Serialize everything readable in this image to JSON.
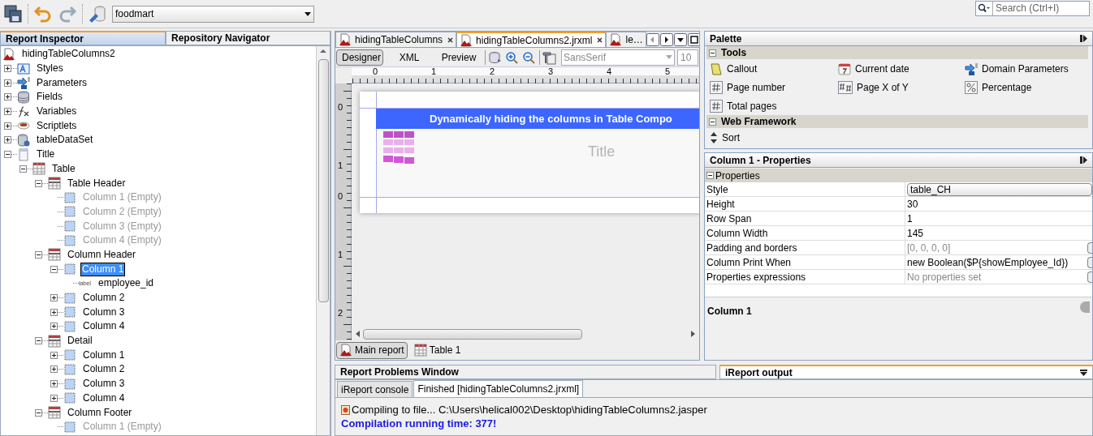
{
  "toolbar": {
    "datasource": "foodmart",
    "search_placeholder": "Search (Ctrl+I)"
  },
  "inspector": {
    "tabs": [
      {
        "label": "Report Inspector",
        "selected": true
      },
      {
        "label": "Repository Navigator",
        "selected": false
      }
    ],
    "tree": {
      "label": "hidingTableColumns2",
      "kind": "report",
      "selected": false,
      "disabled": false,
      "children": [
        {
          "label": "Styles",
          "kind": "styles",
          "expanded": false,
          "selected": false,
          "disabled": false
        },
        {
          "label": "Parameters",
          "kind": "parameters",
          "expanded": false,
          "selected": false,
          "disabled": false
        },
        {
          "label": "Fields",
          "kind": "fields",
          "expanded": false,
          "selected": false,
          "disabled": false
        },
        {
          "label": "Variables",
          "kind": "variables",
          "expanded": false,
          "selected": false,
          "disabled": false
        },
        {
          "label": "Scriptlets",
          "kind": "scriptlets",
          "expanded": false,
          "selected": false,
          "disabled": false
        },
        {
          "label": "tableDataSet",
          "kind": "dataset",
          "expanded": false,
          "selected": false,
          "disabled": false
        },
        {
          "label": "Title",
          "kind": "band",
          "expanded": true,
          "selected": false,
          "disabled": false,
          "children": [
            {
              "label": "Table",
              "kind": "table",
              "expanded": true,
              "selected": false,
              "disabled": false,
              "children": [
                {
                  "label": "Table Header",
                  "kind": "section",
                  "expanded": true,
                  "selected": false,
                  "disabled": false,
                  "children": [
                    {
                      "label": "Column 1 (Empty)",
                      "kind": "cell",
                      "selected": false,
                      "disabled": true
                    },
                    {
                      "label": "Column 2 (Empty)",
                      "kind": "cell",
                      "selected": false,
                      "disabled": true
                    },
                    {
                      "label": "Column 3 (Empty)",
                      "kind": "cell",
                      "selected": false,
                      "disabled": true
                    },
                    {
                      "label": "Column 4 (Empty)",
                      "kind": "cell",
                      "selected": false,
                      "disabled": true
                    }
                  ]
                },
                {
                  "label": "Column Header",
                  "kind": "section",
                  "expanded": true,
                  "selected": false,
                  "disabled": false,
                  "children": [
                    {
                      "label": "Column 1",
                      "kind": "cell",
                      "expanded": true,
                      "selected": true,
                      "disabled": false,
                      "children": [
                        {
                          "label": "employee_id",
                          "kind": "label",
                          "badge": "label",
                          "selected": false,
                          "disabled": false
                        }
                      ]
                    },
                    {
                      "label": "Column 2",
                      "kind": "cell",
                      "expanded": false,
                      "selected": false,
                      "disabled": false
                    },
                    {
                      "label": "Column 3",
                      "kind": "cell",
                      "expanded": false,
                      "selected": false,
                      "disabled": false
                    },
                    {
                      "label": "Column 4",
                      "kind": "cell",
                      "expanded": false,
                      "selected": false,
                      "disabled": false
                    }
                  ]
                },
                {
                  "label": "Detail",
                  "kind": "section",
                  "expanded": true,
                  "selected": false,
                  "disabled": false,
                  "children": [
                    {
                      "label": "Column 1",
                      "kind": "cell",
                      "expanded": false,
                      "selected": false,
                      "disabled": false
                    },
                    {
                      "label": "Column 2",
                      "kind": "cell",
                      "expanded": false,
                      "selected": false,
                      "disabled": false
                    },
                    {
                      "label": "Column 3",
                      "kind": "cell",
                      "expanded": false,
                      "selected": false,
                      "disabled": false
                    },
                    {
                      "label": "Column 4",
                      "kind": "cell",
                      "expanded": false,
                      "selected": false,
                      "disabled": false
                    }
                  ]
                },
                {
                  "label": "Column Footer",
                  "kind": "section",
                  "expanded": true,
                  "selected": false,
                  "disabled": false,
                  "children": [
                    {
                      "label": "Column 1 (Empty)",
                      "kind": "cell",
                      "selected": false,
                      "disabled": true
                    }
                  ]
                }
              ]
            }
          ]
        }
      ]
    }
  },
  "designer": {
    "file_tabs": [
      {
        "label": "hidingTableColumns",
        "selected": false,
        "closable": true
      },
      {
        "label": "hidingTableColumns2.jrxml",
        "selected": true,
        "closable": true
      },
      {
        "label": "le…",
        "selected": false,
        "closable": false
      }
    ],
    "view_tabs": [
      {
        "label": "Designer",
        "selected": true
      },
      {
        "label": "XML",
        "selected": false
      },
      {
        "label": "Preview",
        "selected": false
      }
    ],
    "font": "SansSerif",
    "font_size": "10",
    "ruler_h": [
      "0",
      "1",
      "2",
      "3",
      "4",
      "5"
    ],
    "ruler_v": [
      "0",
      "1",
      "0",
      "1",
      "2"
    ],
    "band_title": "Dynamically hiding the columns in Table Compo",
    "title_placeholder": "Title",
    "report_tabs": [
      {
        "label": "Main report",
        "kind": "report",
        "selected": true
      },
      {
        "label": "Table 1",
        "kind": "table",
        "selected": false
      }
    ]
  },
  "palette": {
    "title": "Palette",
    "sections": [
      {
        "label": "Tools",
        "expanded": true,
        "items": [
          {
            "label": "Callout",
            "kind": "callout"
          },
          {
            "label": "Current date",
            "kind": "calendar"
          },
          {
            "label": "Domain Parameters",
            "kind": "parameters"
          },
          {
            "label": "Page number",
            "kind": "hash"
          },
          {
            "label": "Page X of Y",
            "kind": "hash2"
          },
          {
            "label": "Percentage",
            "kind": "percent"
          },
          {
            "label": "Total pages",
            "kind": "hash"
          }
        ]
      },
      {
        "label": "Web Framework",
        "expanded": true,
        "items": [
          {
            "label": "Sort",
            "kind": "sort"
          }
        ]
      }
    ]
  },
  "properties": {
    "title": "Column 1 - Properties",
    "group": {
      "label": "Properties",
      "expanded": true
    },
    "rows": [
      {
        "name": "Style",
        "value": "table_CH",
        "kind": "combo",
        "disabled": false
      },
      {
        "name": "Height",
        "value": "30",
        "kind": "text",
        "disabled": false
      },
      {
        "name": "Row Span",
        "value": "1",
        "kind": "text",
        "disabled": false
      },
      {
        "name": "Column Width",
        "value": "145",
        "kind": "text",
        "disabled": false
      },
      {
        "name": "Padding and borders",
        "value": "[0, 0, 0, 0]",
        "kind": "editor",
        "disabled": true
      },
      {
        "name": "Column Print When",
        "value": "new Boolean($P{showEmployee_Id})",
        "kind": "editor",
        "disabled": false
      },
      {
        "name": "Properties expressions",
        "value": "No properties set",
        "kind": "editor",
        "disabled": true
      }
    ],
    "description": "Column 1"
  },
  "output": {
    "windows": [
      {
        "label": "Report Problems Window",
        "selected": false
      },
      {
        "label": "iReport output",
        "selected": true
      }
    ],
    "tabs": [
      {
        "label": "iReport console",
        "selected": false
      },
      {
        "label": "Finished [hidingTableColumns2.jrxml]",
        "selected": true
      }
    ],
    "lines": [
      {
        "text": "Compiling to file... C:\\Users\\helical002\\Desktop\\hidingTableColumns2.jasper",
        "kind": "info"
      },
      {
        "text": "Compilation running time: 377!",
        "kind": "summary"
      }
    ]
  }
}
